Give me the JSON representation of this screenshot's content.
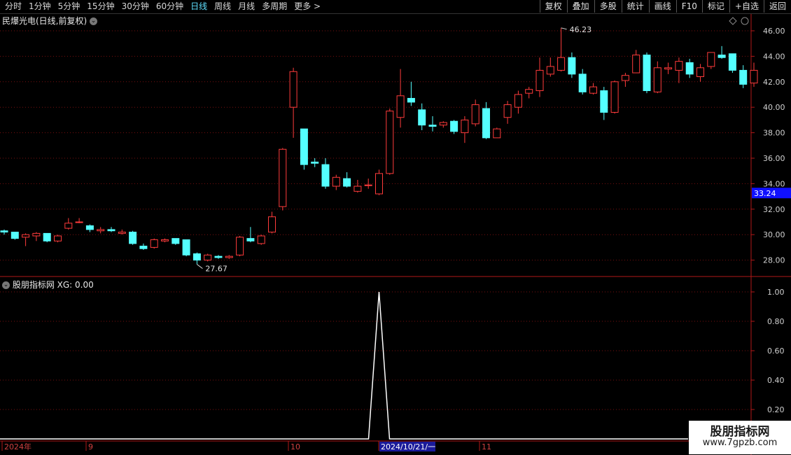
{
  "toolbar": {
    "periods": [
      "分时",
      "1分钟",
      "5分钟",
      "15分钟",
      "30分钟",
      "60分钟",
      "日线",
      "周线",
      "月线",
      "多周期",
      "更多 >"
    ],
    "active_period": "日线",
    "actions": [
      "复权",
      "叠加",
      "多股",
      "统计",
      "画线",
      "F10",
      "标记",
      "+自选",
      "返回"
    ]
  },
  "main_title": "民爆光电(日线,前复权)",
  "indicator_title": "股朋指标网 XG: 0.00",
  "watermark": {
    "line1": "股朋指标网",
    "line2": "www.7gpzb.com"
  },
  "colors": {
    "up": "#ff3b3b",
    "down": "#54ffff",
    "grid": "#7a1010",
    "current_price_bg": "#1010ff"
  },
  "chart_data": [
    {
      "type": "candlestick",
      "title": "民爆光电(日线,前复权)",
      "ylim": [
        27,
        47
      ],
      "y_ticks": [
        28.0,
        30.0,
        32.0,
        34.0,
        36.0,
        38.0,
        40.0,
        42.0,
        44.0,
        46.0
      ],
      "current_price": "33.24",
      "high_label": "46.23",
      "low_label": "27.67",
      "x_labels": [
        "2024年",
        "9",
        "10",
        "2024/10/21/一",
        "11"
      ],
      "candles": [
        [
          30.3,
          30.2,
          30.4,
          30.0
        ],
        [
          30.2,
          29.7,
          30.2,
          29.6
        ],
        [
          29.8,
          30.0,
          30.1,
          29.1
        ],
        [
          29.9,
          30.1,
          30.2,
          29.5
        ],
        [
          30.1,
          29.5,
          30.1,
          29.4
        ],
        [
          29.5,
          29.9,
          30.0,
          29.4
        ],
        [
          30.5,
          30.9,
          31.3,
          30.4
        ],
        [
          31.0,
          31.0,
          31.3,
          30.9
        ],
        [
          30.7,
          30.4,
          30.8,
          30.2
        ],
        [
          30.3,
          30.4,
          30.6,
          30.1
        ],
        [
          30.4,
          30.3,
          30.6,
          30.2
        ],
        [
          30.1,
          30.2,
          30.4,
          30.0
        ],
        [
          30.2,
          29.3,
          30.3,
          29.2
        ],
        [
          29.1,
          28.9,
          29.3,
          28.8
        ],
        [
          29.0,
          29.6,
          29.7,
          28.9
        ],
        [
          29.5,
          29.6,
          29.7,
          29.4
        ],
        [
          29.7,
          29.3,
          29.7,
          29.2
        ],
        [
          29.6,
          28.4,
          29.6,
          28.3
        ],
        [
          28.5,
          28.0,
          28.6,
          27.67
        ],
        [
          28.0,
          28.4,
          28.5,
          27.9
        ],
        [
          28.3,
          28.2,
          28.4,
          28.1
        ],
        [
          28.2,
          28.3,
          28.4,
          28.1
        ],
        [
          28.4,
          29.8,
          29.9,
          28.3
        ],
        [
          29.7,
          29.5,
          30.6,
          29.4
        ],
        [
          29.3,
          29.9,
          30.0,
          29.2
        ],
        [
          30.2,
          31.4,
          31.8,
          30.1
        ],
        [
          32.2,
          36.7,
          36.8,
          31.9
        ],
        [
          40.0,
          42.8,
          43.1,
          37.6
        ],
        [
          38.3,
          35.5,
          38.3,
          35.1
        ],
        [
          35.7,
          35.6,
          36.0,
          35.3
        ],
        [
          35.5,
          33.8,
          36.0,
          33.6
        ],
        [
          33.8,
          34.5,
          34.7,
          33.5
        ],
        [
          34.4,
          33.8,
          34.9,
          33.7
        ],
        [
          33.4,
          33.8,
          34.3,
          33.3
        ],
        [
          33.9,
          33.9,
          34.4,
          33.6
        ],
        [
          33.2,
          34.8,
          35.1,
          33.1
        ],
        [
          34.8,
          39.7,
          39.9,
          34.7
        ],
        [
          39.2,
          40.9,
          43.0,
          38.4
        ],
        [
          40.7,
          40.4,
          42.0,
          40.1
        ],
        [
          39.8,
          38.6,
          40.3,
          38.2
        ],
        [
          38.6,
          38.5,
          39.3,
          38.1
        ],
        [
          38.6,
          38.8,
          38.9,
          38.4
        ],
        [
          38.9,
          38.1,
          39.0,
          37.9
        ],
        [
          38.0,
          39.0,
          39.3,
          37.2
        ],
        [
          38.7,
          40.2,
          40.6,
          38.5
        ],
        [
          39.9,
          37.6,
          40.4,
          37.5
        ],
        [
          37.6,
          38.3,
          38.4,
          37.6
        ],
        [
          39.2,
          40.2,
          40.5,
          38.7
        ],
        [
          40.0,
          41.0,
          41.3,
          39.5
        ],
        [
          41.1,
          41.4,
          41.6,
          40.7
        ],
        [
          41.3,
          42.9,
          43.9,
          40.8
        ],
        [
          42.6,
          43.2,
          43.9,
          42.4
        ],
        [
          42.9,
          43.9,
          46.23,
          42.8
        ],
        [
          43.9,
          42.6,
          44.3,
          42.3
        ],
        [
          42.6,
          41.2,
          43.0,
          41.0
        ],
        [
          41.1,
          41.6,
          41.9,
          41.0
        ],
        [
          41.3,
          39.6,
          41.6,
          39.0
        ],
        [
          39.6,
          42.0,
          42.1,
          39.5
        ],
        [
          42.1,
          42.5,
          42.7,
          41.6
        ],
        [
          42.7,
          44.1,
          44.5,
          42.7
        ],
        [
          44.1,
          41.3,
          44.3,
          41.1
        ],
        [
          41.2,
          43.1,
          43.6,
          41.1
        ],
        [
          43.0,
          43.1,
          43.5,
          42.6
        ],
        [
          42.9,
          43.6,
          43.9,
          41.9
        ],
        [
          43.5,
          42.6,
          43.8,
          42.3
        ],
        [
          42.4,
          43.1,
          43.4,
          42.0
        ],
        [
          43.2,
          44.3,
          44.3,
          43.0
        ],
        [
          44.1,
          43.9,
          44.8,
          43.8
        ],
        [
          44.2,
          42.9,
          44.2,
          42.7
        ],
        [
          42.9,
          41.8,
          43.3,
          41.5
        ],
        [
          41.9,
          42.9,
          43.5,
          41.6
        ]
      ]
    },
    {
      "type": "line",
      "title": "股朋指标网 XG: 0.00",
      "ylim": [
        0,
        1.05
      ],
      "y_ticks": [
        0.2,
        0.4,
        0.6,
        0.8,
        1.0
      ],
      "series": [
        {
          "name": "XG",
          "spike_index": 35,
          "values_note": ""
        }
      ]
    }
  ]
}
